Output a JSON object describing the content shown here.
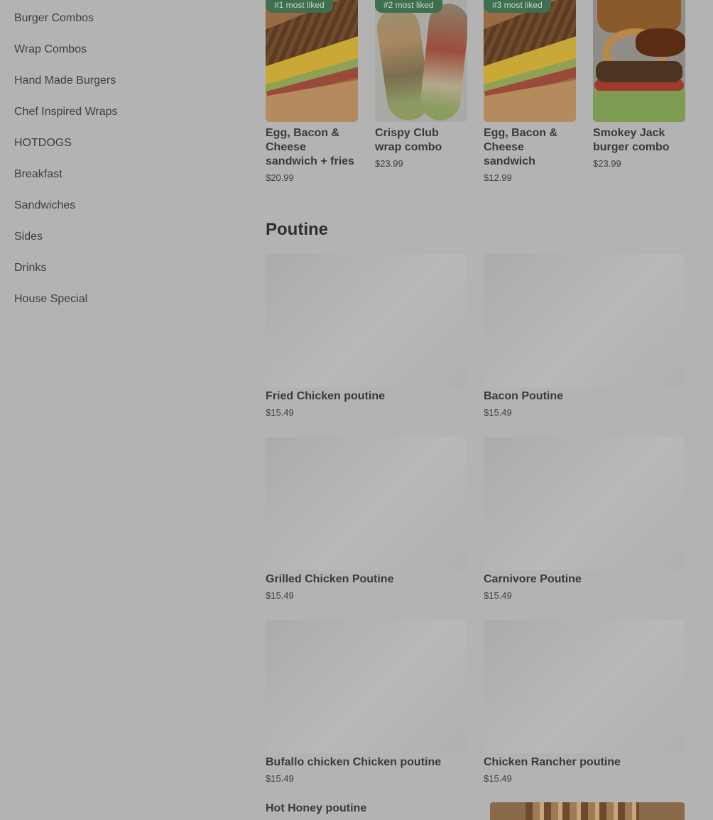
{
  "sidebar": {
    "items": [
      {
        "label": "Burger Combos"
      },
      {
        "label": "Wrap Combos"
      },
      {
        "label": "Hand Made Burgers"
      },
      {
        "label": "Chef Inspired Wraps"
      },
      {
        "label": "HOTDOGS"
      },
      {
        "label": "Breakfast"
      },
      {
        "label": "Sandwiches"
      },
      {
        "label": "Sides"
      },
      {
        "label": "Drinks"
      },
      {
        "label": "House Special"
      }
    ]
  },
  "featured": [
    {
      "badge": "#1 most liked",
      "title": "Egg, Bacon & Cheese sandwich + fries",
      "price": "$20.99",
      "image": "sandwich"
    },
    {
      "badge": "#2 most liked",
      "title": "Crispy Club wrap combo",
      "price": "$23.99",
      "image": "wrap"
    },
    {
      "badge": "#3 most liked",
      "title": "Egg, Bacon & Cheese sandwich",
      "price": "$12.99",
      "image": "sandwich"
    },
    {
      "badge": "",
      "title": "Smokey Jack burger combo",
      "price": "$23.99",
      "image": "burger"
    }
  ],
  "poutine": {
    "title": "Poutine",
    "items": [
      {
        "name": "Fried Chicken poutine",
        "price": "$15.49"
      },
      {
        "name": "Bacon Poutine",
        "price": "$15.49"
      },
      {
        "name": "Grilled Chicken Poutine",
        "price": "$15.49"
      },
      {
        "name": "Carnivore Poutine",
        "price": "$15.49"
      },
      {
        "name": "Bufallo chicken Chicken poutine",
        "price": "$15.49"
      },
      {
        "name": "Chicken Rancher poutine",
        "price": "$15.49"
      }
    ],
    "partial_item": {
      "name": "Hot Honey poutine"
    }
  }
}
